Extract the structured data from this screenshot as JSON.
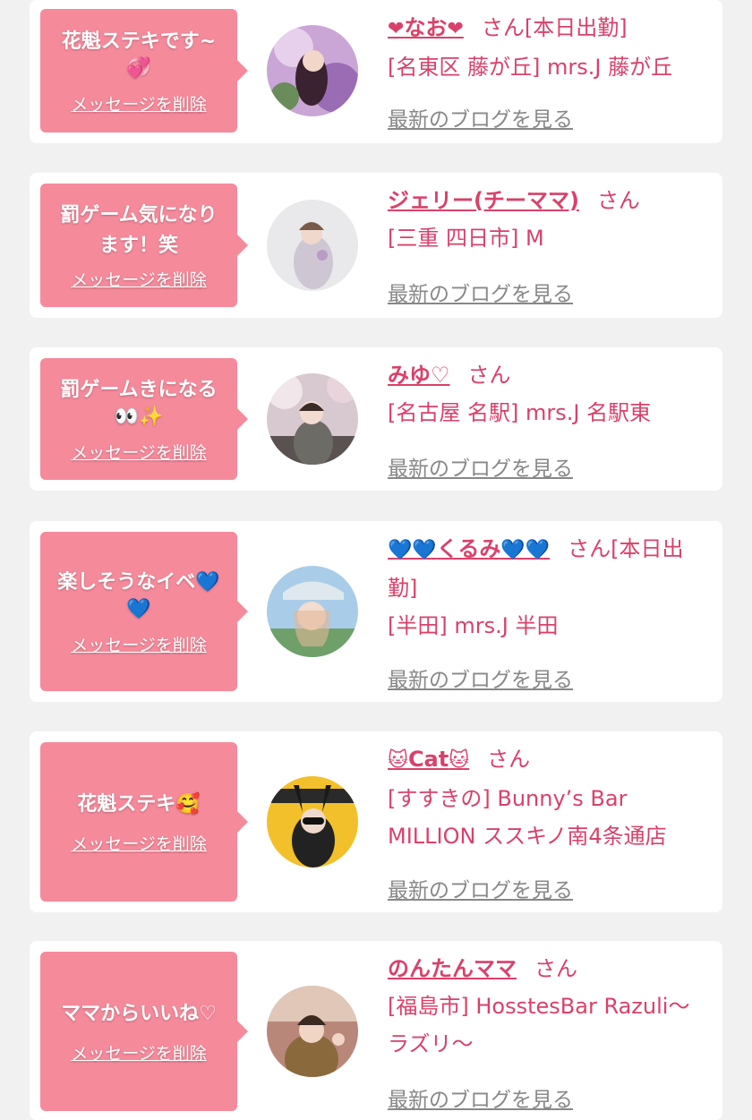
{
  "common": {
    "delete_label": "メッセージを削除",
    "san": "さん",
    "blog_label": "最新のブログを見る"
  },
  "colors": {
    "bubble": "#f58a9b",
    "accent": "#d9416a",
    "link_gray": "#888888",
    "background": "#f1f1f1"
  },
  "items": [
    {
      "message_line1": "花魁ステキです~",
      "message_line2": "💞",
      "name_prefix": "❤",
      "name": "なお",
      "name_suffix": "❤",
      "status": "[本日出勤]",
      "location_line1": "[名東区 藤が丘] mrs.J 藤が丘",
      "location_line2": ""
    },
    {
      "message_line1": "罰ゲーム気になり",
      "message_line2": "ます！笑",
      "name_prefix": "",
      "name": "ジェリー(チーママ)",
      "name_suffix": "",
      "status": "",
      "location_line1": "[三重 四日市] M",
      "location_line2": ""
    },
    {
      "message_line1": "罰ゲームきになる",
      "message_line2": "👀✨",
      "name_prefix": "",
      "name": "みゆ♡",
      "name_suffix": "",
      "status": "",
      "location_line1": "[名古屋 名駅] mrs.J 名駅東",
      "location_line2": ""
    },
    {
      "message_line1": "楽しそうなイベ💙",
      "message_line2": "💙",
      "name_prefix": "💙💙",
      "name": "くるみ",
      "name_suffix": "💙💙",
      "status": "[本日出",
      "status_line2": "勤]",
      "location_line1": "[半田] mrs.J 半田",
      "location_line2": ""
    },
    {
      "message_line1": "花魁ステキ🥰",
      "message_line2": "",
      "name_prefix": "🐱",
      "name": "Cat",
      "name_suffix": "🐱",
      "status": "",
      "location_line1": "[すすきの] Bunny’s Bar",
      "location_line2": "MILLION ススキノ南4条通店"
    },
    {
      "message_line1": "ママからいいね♡",
      "message_line2": "",
      "name_prefix": "",
      "name": "のんたんママ",
      "name_suffix": "",
      "status": "",
      "location_line1": "[福島市] HosstesBar Razuli〜",
      "location_line2": "ラズリ〜"
    }
  ]
}
